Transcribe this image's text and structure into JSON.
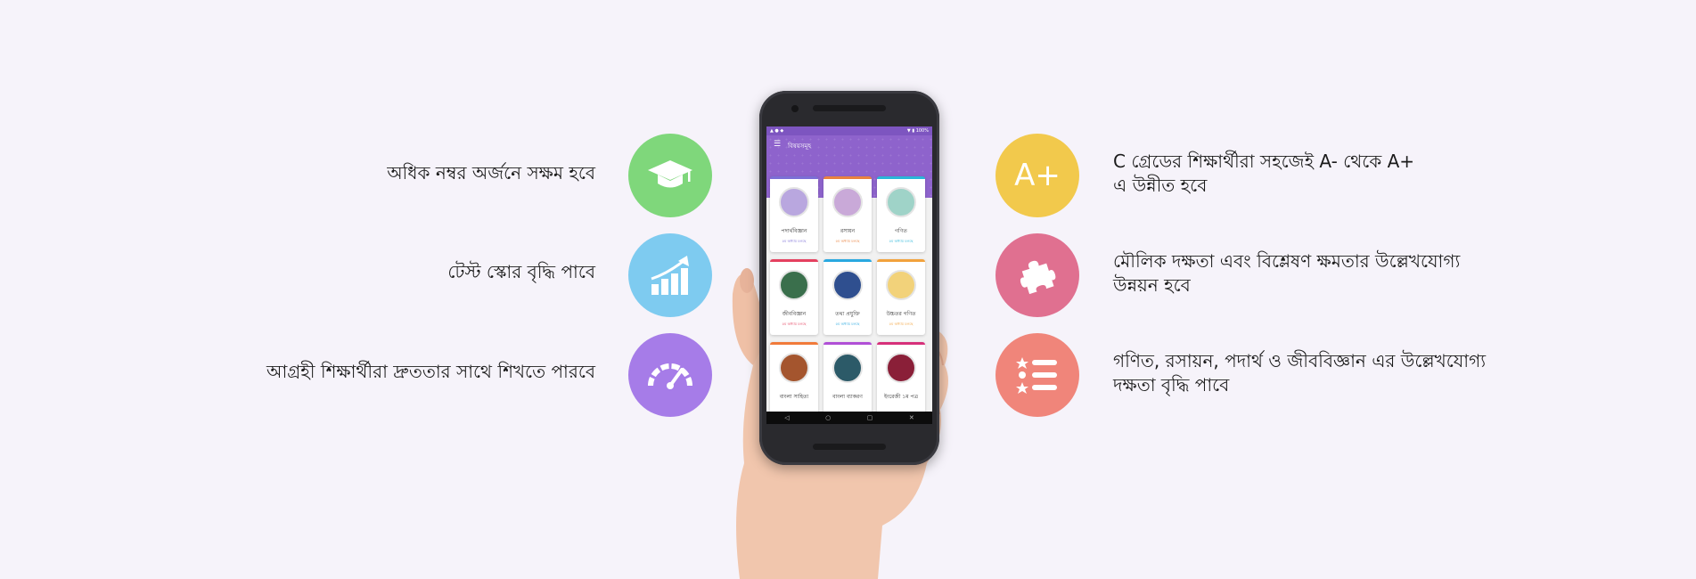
{
  "left_features": [
    {
      "text": "অধিক নম্বর অর্জনে সক্ষম হবে",
      "icon": "graduation-cap-icon",
      "color": "#7fd77b"
    },
    {
      "text": "টেস্ট স্কোর বৃদ্ধি পাবে",
      "icon": "growth-chart-icon",
      "color": "#7ecbf0"
    },
    {
      "text": "আগ্রহী শিক্ষার্থীরা দ্রুততার সাথে শিখতে পারবে",
      "icon": "speedometer-icon",
      "color": "#a67ce8"
    }
  ],
  "right_features": [
    {
      "line1": "C গ্রেডের শিক্ষার্থীরা সহজেই A- থেকে A+",
      "line2": "এ উন্নীত হবে",
      "icon": "a-plus-icon",
      "icon_text": "A+",
      "color": "#f2c94c"
    },
    {
      "line1": "মৌলিক দক্ষতা এবং বিশ্লেষণ ক্ষমতার উল্লেখযোগ্য",
      "line2": "উন্নয়ন হবে",
      "icon": "puzzle-icon",
      "color": "#e07090"
    },
    {
      "line1": "গণিত, রসায়ন, পদার্থ ও জীববিজ্ঞান এর উল্লেখযোগ্য",
      "line2": "দক্ষতা বৃদ্ধি পাবে",
      "icon": "checklist-icon",
      "color": "#f0857a"
    }
  ],
  "phone": {
    "app_title": "বিষয়সমূহ",
    "subjects": [
      {
        "name": "পদার্থবিজ্ঞান",
        "sub": "৫ম অধ্যায় চলছে",
        "accent": "#7c6fd6",
        "thumb": "#b9a7df"
      },
      {
        "name": "রসায়ন",
        "sub": "৫ম অধ্যায় চলছে",
        "accent": "#e9823f",
        "thumb": "#c9a9d8"
      },
      {
        "name": "গণিত",
        "sub": "৫ম অধ্যায় চলছে",
        "accent": "#29b6d8",
        "thumb": "#9fd3c8"
      },
      {
        "name": "জীববিজ্ঞান",
        "sub": "৫ম অধ্যায় চলছে",
        "accent": "#e4405f",
        "thumb": "#3a6f4c"
      },
      {
        "name": "তথ্য প্রযুক্তি",
        "sub": "৫ম অধ্যায় চলছে",
        "accent": "#29a8e0",
        "thumb": "#2f4f8f"
      },
      {
        "name": "উচ্চতর গণিত",
        "sub": "৫ম অধ্যায় চলছে",
        "accent": "#f2a23c",
        "thumb": "#f2d27a"
      },
      {
        "name": "বাংলা সাহিত্য",
        "sub": "",
        "accent": "#f07a3a",
        "thumb": "#a4552e"
      },
      {
        "name": "বাংলা ব্যাকরণ",
        "sub": "",
        "accent": "#b04fd6",
        "thumb": "#2c5a68"
      },
      {
        "name": "ইংরেজী ১ম পত্র",
        "sub": "",
        "accent": "#d6307a",
        "thumb": "#8a1f38"
      }
    ]
  }
}
